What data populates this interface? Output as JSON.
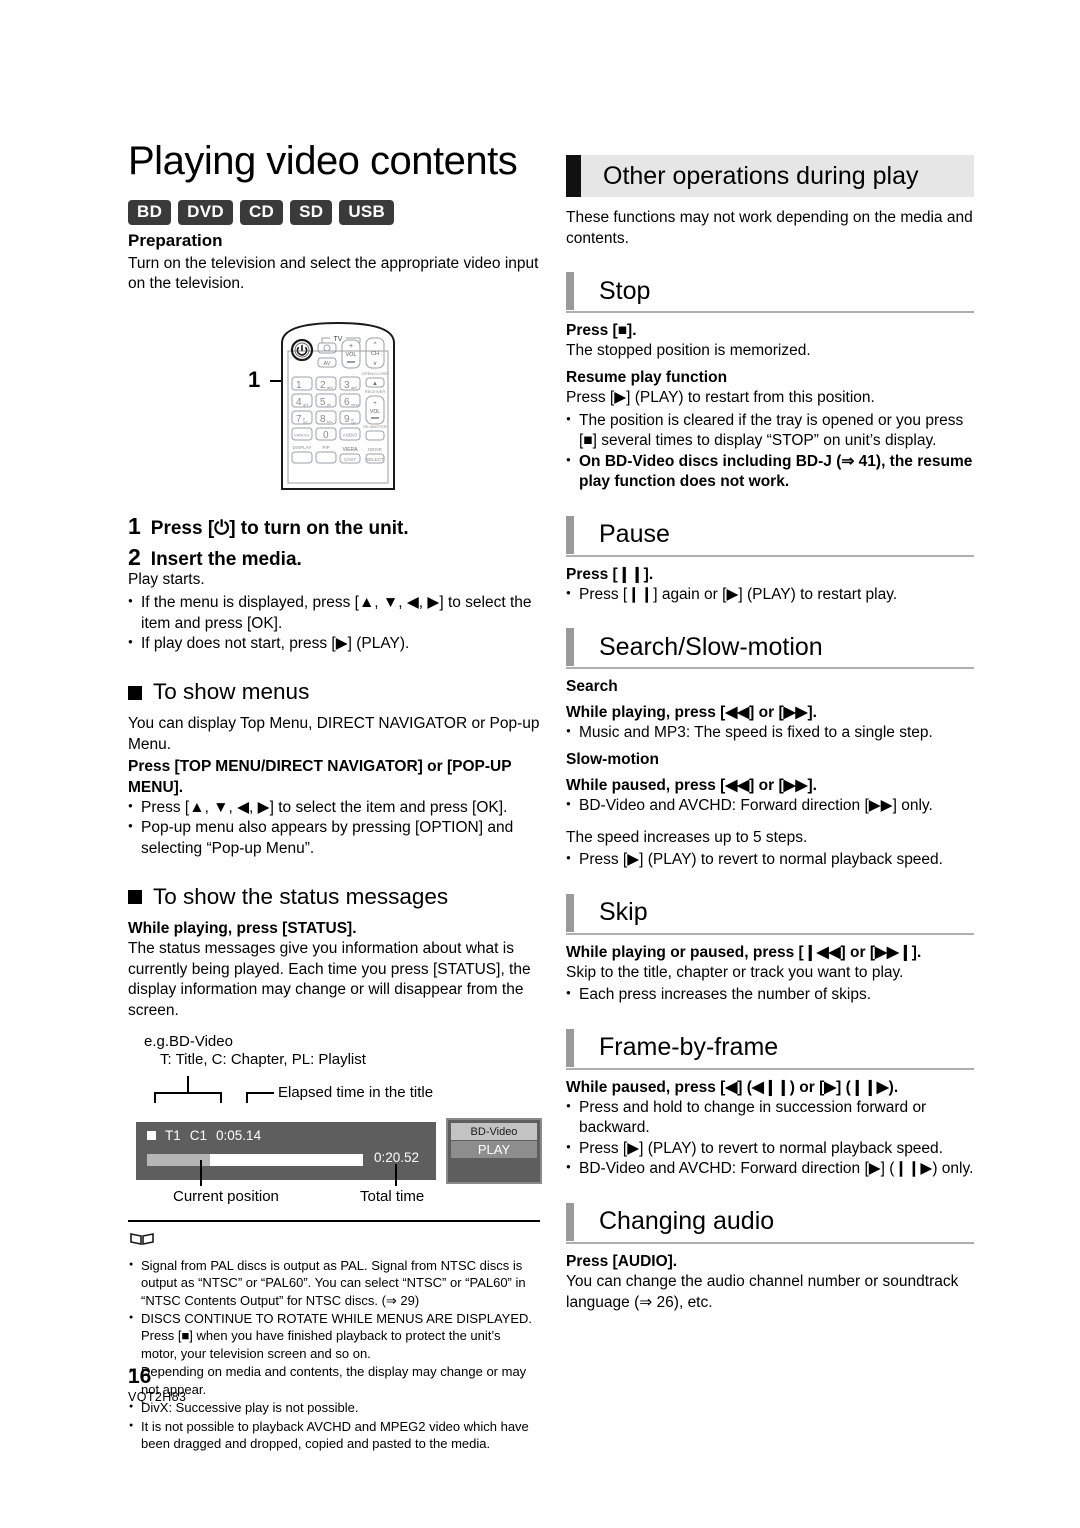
{
  "document": {
    "title": "Playing video contents",
    "page_number": "16",
    "model_code": "VQT2H83"
  },
  "media_badges": [
    "BD",
    "DVD",
    "CD",
    "SD",
    "USB"
  ],
  "preparation": {
    "heading": "Preparation",
    "text": "Turn on the television and select the appropriate video input on the television."
  },
  "remote_figure": {
    "callout": "1",
    "tv_label": "TV",
    "power_icon": "power-icon",
    "keys": {
      "tv_power": "⊙",
      "av": "AV",
      "vol_plus": "+",
      "vol_label": "VOL",
      "vol_minus": "−",
      "ch_up": "∧",
      "ch_label": "CH",
      "ch_down": "∨",
      "k1": "1",
      "k2": "2",
      "k2s": "abc",
      "k3": "3",
      "k3s": "def",
      "k4": "4",
      "k4s": "ghi",
      "k5": "5",
      "k5s": "jkl",
      "k6": "6",
      "k6s": "mno",
      "k7": "7",
      "k7s": "pqrs",
      "k8": "8",
      "k8s": "tuv",
      "k9": "9",
      "k9s": "wxyz",
      "k0": "0",
      "cancel": "CANCEL",
      "audio": "AUDIO",
      "open_close": "OPEN/CLOSE",
      "receiver": "RECEIVER",
      "re_master": "RE-MASTER",
      "display": "DISPLAY",
      "pip": "PIP",
      "viera": "VIERA",
      "cast": "CAST",
      "drive": "DRIVE",
      "select": "SELECT"
    }
  },
  "steps": [
    {
      "num": "1",
      "text": "Press [⏻] to turn on the unit."
    },
    {
      "num": "2",
      "text": "Insert the media."
    }
  ],
  "step_notes": {
    "lead": "Play starts.",
    "bullets": [
      "If the menu is displayed, press [▲, ▼, ◀, ▶] to select the item and press [OK].",
      "If play does not start, press [▶] (PLAY)."
    ]
  },
  "show_menus": {
    "heading": "To show menus",
    "intro": "You can display Top Menu, DIRECT NAVIGATOR or Pop-up Menu.",
    "bold_instruction": "Press [TOP MENU/DIRECT NAVIGATOR] or [POP-UP MENU].",
    "bullets": [
      "Press [▲, ▼, ◀, ▶] to select the item and press [OK].",
      "Pop-up menu also appears by pressing [OPTION] and selecting “Pop-up Menu”."
    ]
  },
  "status_messages": {
    "heading": "To show the status messages",
    "bold_instruction": "While playing, press [STATUS].",
    "body": "The status messages give you information about what is currently being played. Each time you press [STATUS], the display information may change or will disappear from the screen.",
    "figure": {
      "example_label": "e.g.BD-Video",
      "legend": "T: Title, C: Chapter, PL: Playlist",
      "elapsed_label": "Elapsed time in the title",
      "current_position_label": "Current position",
      "total_time_label": "Total time",
      "osd": {
        "title_marker": "T1",
        "chapter_marker": "C1",
        "elapsed_time": "0:05.14",
        "total_time": "0:20.52",
        "progress_percent": 29,
        "side_panel": {
          "media_type": "BD-Video",
          "state": "PLAY"
        }
      }
    }
  },
  "notes": {
    "icon": "book-icon",
    "items": [
      "Signal from PAL discs is output as PAL. Signal from NTSC discs is output as “NTSC” or “PAL60”. You can select “NTSC” or “PAL60” in “NTSC Contents Output” for NTSC discs. (⇒ 29)",
      "DISCS CONTINUE TO ROTATE WHILE MENUS ARE DISPLAYED. Press [■] when you have finished playback to protect the unit’s motor, your television screen and so on.",
      "Depending on media and contents, the display may change or may not appear.",
      "DivX: Successive play is not possible.",
      "It is not possible to playback AVCHD and MPEG2 video which have been dragged and dropped, copied and pasted to the media."
    ]
  },
  "right": {
    "banner_title": "Other operations during play",
    "intro": "These functions may not work depending on the media and contents.",
    "sections": [
      {
        "title": "Stop",
        "lines": [
          {
            "type": "bold",
            "text": "Press [■]."
          },
          {
            "type": "plain",
            "text": "The stopped position is memorized."
          },
          {
            "type": "bold",
            "text": "Resume play function"
          },
          {
            "type": "plain",
            "text": "Press [▶] (PLAY) to restart from this position."
          }
        ],
        "bullets": [
          {
            "text": "The position is cleared if the tray is opened or you press [■] several times to display “STOP” on unit’s display.",
            "bold": false
          },
          {
            "text": "On BD-Video discs including BD-J (⇒ 41), the resume play function does not work.",
            "bold": true
          }
        ]
      },
      {
        "title": "Pause",
        "lines": [
          {
            "type": "bold",
            "text": "Press [❙❙]."
          }
        ],
        "bullets": [
          {
            "text": "Press [❙❙] again or [▶] (PLAY) to restart play.",
            "bold": false
          }
        ]
      },
      {
        "title": "Search/Slow-motion",
        "lines": [
          {
            "type": "bold",
            "text": "Search"
          },
          {
            "type": "bold",
            "text": "While playing, press [◀◀] or [▶▶]."
          }
        ],
        "bullets": [
          {
            "text": "Music and MP3: The speed is fixed to a single step.",
            "bold": false
          }
        ],
        "lines2": [
          {
            "type": "bold",
            "text": "Slow-motion"
          },
          {
            "type": "bold",
            "text": "While paused, press [◀◀] or [▶▶]."
          }
        ],
        "bullets2": [
          {
            "text": "BD-Video and AVCHD: Forward direction [▶▶] only.",
            "bold": false
          }
        ],
        "lines3": [
          {
            "type": "plain",
            "text": "The speed increases up to 5 steps."
          }
        ],
        "bullets3": [
          {
            "text": "Press [▶] (PLAY) to revert to normal playback speed.",
            "bold": false
          }
        ]
      },
      {
        "title": "Skip",
        "lines": [
          {
            "type": "bold",
            "text": "While playing or paused, press [❙◀◀] or [▶▶❙]."
          },
          {
            "type": "plain",
            "text": "Skip to the title, chapter or track you want to play."
          }
        ],
        "bullets": [
          {
            "text": "Each press increases the number of skips.",
            "bold": false
          }
        ]
      },
      {
        "title": "Frame-by-frame",
        "lines": [
          {
            "type": "bold",
            "text": "While paused, press [◀] (◀❙❙) or [▶] (❙❙▶)."
          }
        ],
        "bullets": [
          {
            "text": "Press and hold to change in succession forward or backward.",
            "bold": false
          },
          {
            "text": "Press [▶] (PLAY) to revert to normal playback speed.",
            "bold": false
          },
          {
            "text": "BD-Video and AVCHD: Forward direction [▶] (❙❙▶) only.",
            "bold": false
          }
        ]
      },
      {
        "title": "Changing audio",
        "lines": [
          {
            "type": "bold",
            "text": "Press [AUDIO]."
          },
          {
            "type": "plain",
            "text": "You can change the audio channel number or soundtrack language (⇒ 26), etc."
          }
        ],
        "bullets": []
      }
    ]
  },
  "colors": {
    "badge_bg": "#3a3a3a",
    "banner_bg": "#e6e6e6",
    "banner_tab": "#111111",
    "section_bar": "#9a9a9a",
    "section_rule": "#aeaeae",
    "osd_bg": "#5e5e5e",
    "osd_fill": "#b5b5b5"
  }
}
